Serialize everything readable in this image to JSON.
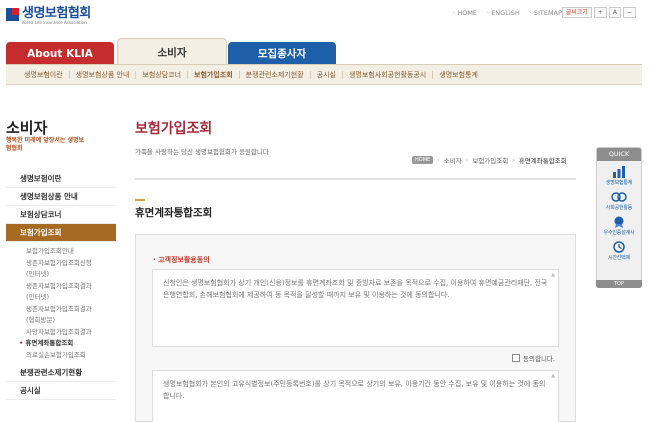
{
  "logo": {
    "name": "생명보험협회",
    "sub": "Korea Life Insurance Association"
  },
  "util_links": [
    "HOME",
    "ENGLISH",
    "SITEMAP"
  ],
  "tools": {
    "print": "글씨크기",
    "plus": "+",
    "minus": "A",
    "reset": "−"
  },
  "gnb": {
    "about": "About KLIA",
    "consumer": "소비자",
    "recruit": "모집종사자"
  },
  "subnav": [
    "생명보험이란",
    "생명보험상품 안내",
    "보험상담코너",
    "보험가입조회",
    "분쟁관련소제기현황",
    "공시실",
    "생명보험사회공헌활동공시",
    "생명보험통계"
  ],
  "side": {
    "title": "소비자",
    "slogan": "행복한 미래에 앞장서는 생명보험협회",
    "menu": [
      "생명보험이란",
      "생명보험상품 안내",
      "보험상담코너",
      "보험가입조회"
    ],
    "sub": [
      "보험가입조회안내",
      "생존자보험가입조회신청",
      "(인터넷)",
      "생존자보험가입조회결과",
      "(인터넷)",
      "생존자보험가입조회결과",
      "(협회방문)",
      "사망자보험가입조회결과",
      "휴면계좌통합조회",
      "의료실손보험가입조회"
    ],
    "menu_after": [
      "분쟁관련소제기현황",
      "공시실"
    ]
  },
  "content": {
    "title": "보험가입조회",
    "desc": "가족을 사랑하는 당신 생명보험협회가 응원합니다",
    "crumb": {
      "home": "HOME",
      "items": [
        "소비자",
        "보험가입조회",
        "휴면계좌통합조회"
      ]
    },
    "section": "휴면계좌통합조회",
    "consent_title": "고객정보활용동의",
    "consent1": "신청인은 생명보험협회가 상기 개인(신용)정보를 휴면계좌조회 및 증빙자료 보존을 목적으로 수집, 이용하여 휴면예금관리재단, 전국은행연합회, 손해보험협회에 제공하여 동 목적을 달성할 때까지 보유 및 이용하는 것에 동의합니다.",
    "agree_label": "동의합니다.",
    "consent2": "생명보험협회가 본인의 고유식별정보(주민등록번호)를 상기 목적으로 상기의 보유, 이용기간 동안 수집, 보유 및 이용하는 것에 동의합니다."
  },
  "quick": {
    "head": "QUICK",
    "items": [
      {
        "label": "생명보험통계",
        "icon": "chart-icon"
      },
      {
        "label": "사회공헌활동",
        "icon": "handshake-icon"
      },
      {
        "label": "우수인증설계사",
        "icon": "badge-icon"
      },
      {
        "label": "시간선택제",
        "icon": "clock-icon"
      }
    ],
    "top": "TOP"
  }
}
